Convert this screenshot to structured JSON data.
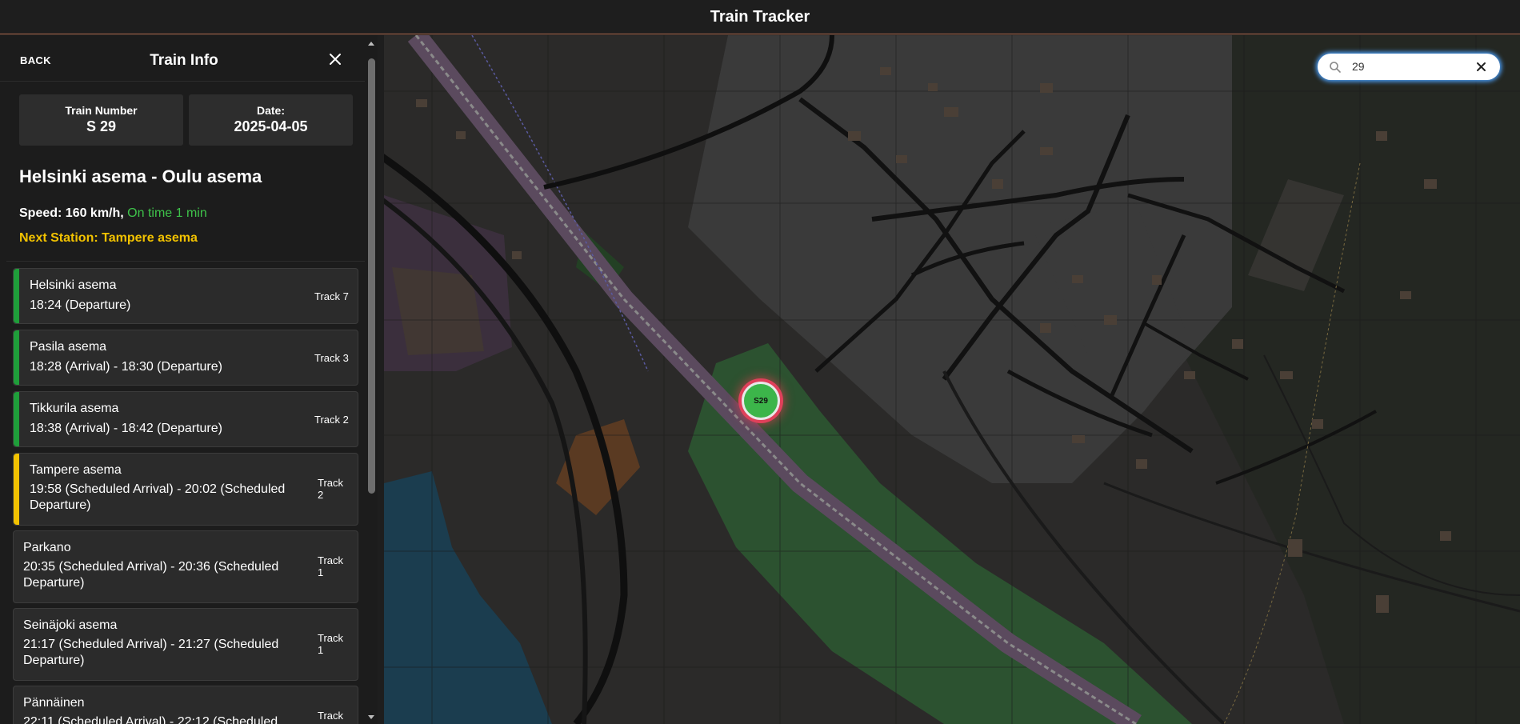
{
  "app": {
    "title": "Train Tracker"
  },
  "panel": {
    "back_label": "BACK",
    "title": "Train Info",
    "close_icon": "close-icon",
    "train_number_label": "Train Number",
    "train_number": "S 29",
    "date_label": "Date:",
    "date": "2025-04-05",
    "route": "Helsinki asema - Oulu asema",
    "speed_text": "Speed: 160 km/h,",
    "on_time_text": "On time 1 min",
    "next_station_text": "Next Station: Tampere asema",
    "colors": {
      "passed": "#1f9e3a",
      "next": "#f2c200",
      "on_time": "#3ec24a"
    },
    "stations": [
      {
        "name": "Helsinki asema",
        "time": "18:24 (Departure)",
        "track": "Track 7",
        "status": "passed"
      },
      {
        "name": "Pasila asema",
        "time": "18:28 (Arrival) - 18:30 (Departure)",
        "track": "Track 3",
        "status": "passed"
      },
      {
        "name": "Tikkurila asema",
        "time": "18:38 (Arrival) - 18:42 (Departure)",
        "track": "Track 2",
        "status": "passed"
      },
      {
        "name": "Tampere asema",
        "time": "19:58 (Scheduled Arrival) - 20:02 (Scheduled Departure)",
        "track": "Track 2",
        "status": "next"
      },
      {
        "name": "Parkano",
        "time": "20:35 (Scheduled Arrival) - 20:36 (Scheduled Departure)",
        "track": "Track 1",
        "status": "upcoming"
      },
      {
        "name": "Seinäjoki asema",
        "time": "21:17 (Scheduled Arrival) - 21:27 (Scheduled Departure)",
        "track": "Track 1",
        "status": "upcoming"
      },
      {
        "name": "Pännäinen",
        "time": "22:11 (Scheduled Arrival) - 22:12 (Scheduled",
        "track": "Track",
        "status": "upcoming"
      }
    ]
  },
  "map": {
    "search_value": "29",
    "search_icon": "search-icon",
    "clear_icon": "clear-icon",
    "train_marker_label": "S29"
  }
}
